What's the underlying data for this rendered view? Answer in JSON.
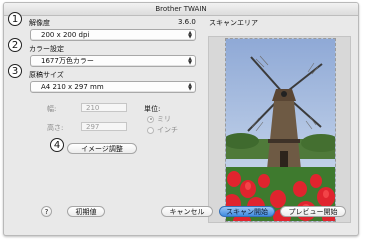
{
  "window": {
    "title": "Brother TWAIN"
  },
  "left_panel": {
    "resolution": {
      "label": "解像度",
      "version": "3.6.0",
      "value": "200 x 200 dpi"
    },
    "color": {
      "label": "カラー設定",
      "value": "1677万色カラー"
    },
    "document_size": {
      "label": "原稿サイズ",
      "value": "A4  210 x 297 mm"
    },
    "width": {
      "label": "幅:",
      "value": "210"
    },
    "height": {
      "label": "高さ:",
      "value": "297"
    },
    "unit": {
      "label": "単位:",
      "options": [
        "ミリ",
        "インチ"
      ],
      "selected": "ミリ"
    },
    "adjust_button": "イメージ調整"
  },
  "scan_area": {
    "label": "スキャンエリア"
  },
  "markers": [
    "1",
    "2",
    "3",
    "4"
  ],
  "footer": {
    "help": "?",
    "defaults_button": "初期値",
    "cancel_button": "キャンセル",
    "scan_button": "スキャン開始",
    "preview_button": "プレビュー開始"
  },
  "colors": {
    "accent": "#3f8be0",
    "window_bg": "#e9e9e9"
  }
}
